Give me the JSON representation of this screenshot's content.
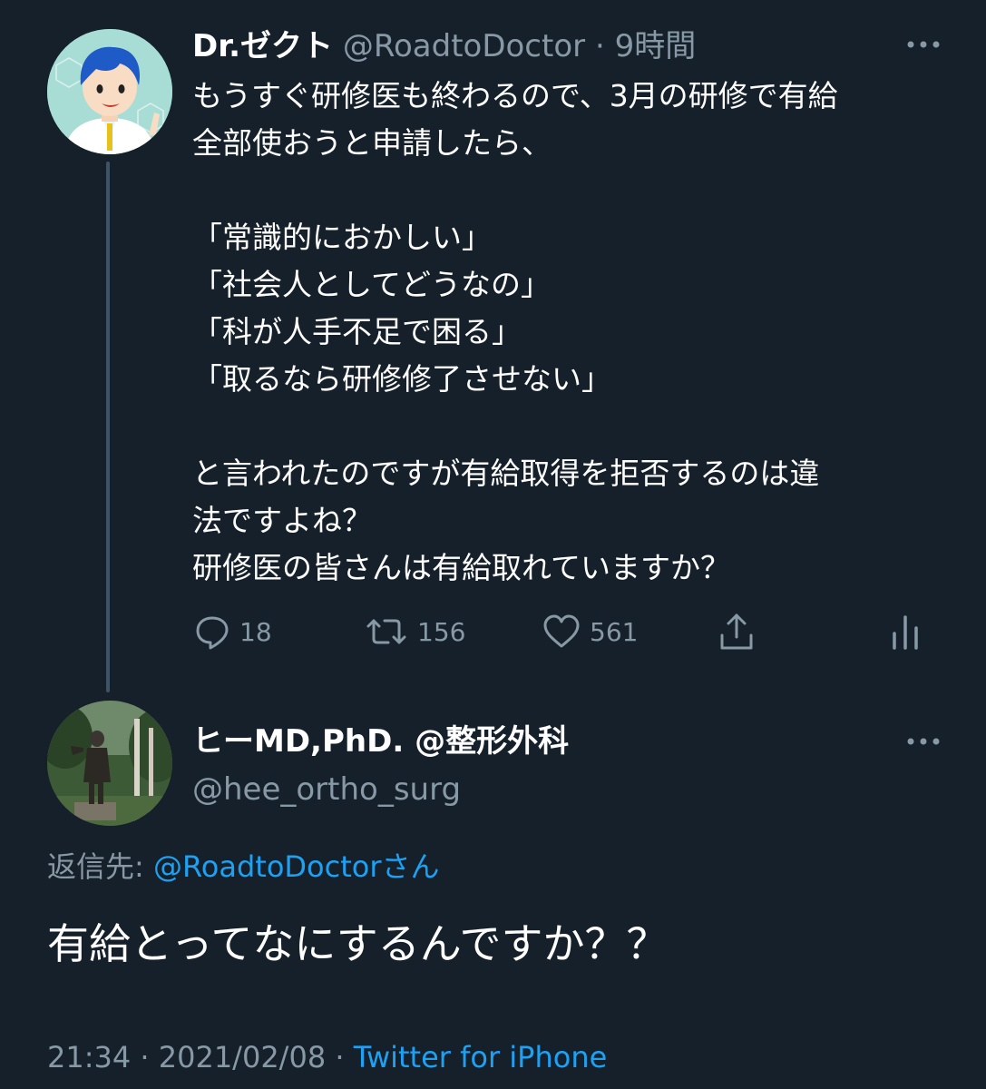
{
  "tweet": {
    "author_name": "Dr.ゼクト",
    "author_handle": "@RoadtoDoctor",
    "separator": "·",
    "time_ago": "9時間",
    "lines": [
      "もうすぐ研修医も終わるので、3月の研修で有給",
      "全部使おうと申請したら、",
      "",
      "「常識的におかしい」",
      "「社会人としてどうなの」",
      "「科が人手不足で困る」",
      "「取るなら研修修了させない」",
      "",
      "と言われたのですが有給取得を拒否するのは違",
      "法ですよね？",
      "研修医の皆さんは有給取れていますか？"
    ],
    "reply_count": "18",
    "retweet_count": "156",
    "like_count": "561",
    "icons": {
      "reply": "reply-icon",
      "retweet": "retweet-icon",
      "like": "heart-icon",
      "share": "share-icon",
      "analytics": "analytics-icon",
      "more": "more-icon"
    }
  },
  "reply": {
    "author_name": "ヒーMD,PhD. @整形外科",
    "author_handle": "@hee_ortho_surg",
    "replying_to_label": "返信先:",
    "replying_to_handle": "@RoadtoDoctorさん",
    "text": "有給とってなにするんですか？？",
    "time": "21:34",
    "date": "2021/02/08",
    "separator": "·",
    "source": "Twitter for iPhone"
  },
  "colors": {
    "background": "#15202b",
    "text": "#ffffff",
    "secondary_text": "#8899a6",
    "link": "#1da1f2",
    "thread_line": "#3d5466"
  }
}
